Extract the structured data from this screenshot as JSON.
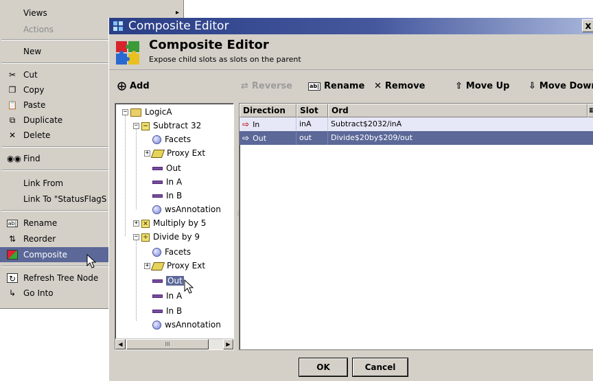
{
  "context_menu": {
    "items": [
      {
        "label": "Views",
        "disabled": false,
        "has_submenu": true
      },
      {
        "label": "Actions",
        "disabled": true
      },
      {
        "label": "New",
        "disabled": false
      },
      {
        "label": "Cut",
        "icon": "scissors-icon"
      },
      {
        "label": "Copy",
        "icon": "copy-icon"
      },
      {
        "label": "Paste",
        "icon": "paste-icon"
      },
      {
        "label": "Duplicate",
        "icon": "duplicate-icon"
      },
      {
        "label": "Delete",
        "icon": "delete-icon"
      },
      {
        "label": "Find",
        "icon": "binoculars-icon"
      },
      {
        "label": "Link From"
      },
      {
        "label": "Link To \"StatusFlagS"
      },
      {
        "label": "Rename",
        "icon": "rename-icon"
      },
      {
        "label": "Reorder",
        "icon": "reorder-icon"
      },
      {
        "label": "Composite",
        "icon": "composite-icon",
        "selected": true
      },
      {
        "label": "Refresh Tree Node",
        "icon": "refresh-icon"
      },
      {
        "label": "Go Into",
        "icon": "go-into-icon"
      }
    ]
  },
  "dialog": {
    "title": "Composite Editor",
    "close_glyph": "x",
    "header_title": "Composite Editor",
    "header_subtitle": "Expose child slots as slots on the parent"
  },
  "toolbar": {
    "add": "Add",
    "reverse": "Reverse",
    "rename": "Rename",
    "remove": "Remove",
    "move_up": "Move Up",
    "move_down": "Move Dowr"
  },
  "tree": {
    "nodes": [
      {
        "label": "LogicA",
        "icon": "folder-icon"
      },
      {
        "label": "Subtract 32",
        "icon": "subtract-block-icon"
      },
      {
        "label": "Facets",
        "icon": "facets-icon"
      },
      {
        "label": "Proxy Ext",
        "icon": "proxy-ext-icon"
      },
      {
        "label": "Out",
        "icon": "slot-icon"
      },
      {
        "label": "In A",
        "icon": "slot-icon"
      },
      {
        "label": "In B",
        "icon": "slot-icon"
      },
      {
        "label": "wsAnnotation",
        "icon": "annotation-icon"
      },
      {
        "label": "Multiply by 5",
        "icon": "multiply-block-icon"
      },
      {
        "label": "Divide by 9",
        "icon": "divide-block-icon"
      },
      {
        "label": "Facets",
        "icon": "facets-icon"
      },
      {
        "label": "Proxy Ext",
        "icon": "proxy-ext-icon"
      },
      {
        "label": "Out",
        "icon": "slot-icon",
        "selected": true
      },
      {
        "label": "In A",
        "icon": "slot-icon"
      },
      {
        "label": "In B",
        "icon": "slot-icon"
      },
      {
        "label": "wsAnnotation",
        "icon": "annotation-icon"
      }
    ],
    "scroll_thumb_label": "III"
  },
  "table": {
    "columns": [
      "Direction",
      "Slot",
      "Ord"
    ],
    "rows": [
      {
        "direction": "In",
        "slot": "inA",
        "ord": "Subtract$2032/inA"
      },
      {
        "direction": "Out",
        "slot": "out",
        "ord": "Divide$20by$209/out"
      }
    ]
  },
  "footer": {
    "ok": "OK",
    "cancel": "Cancel"
  },
  "colors": {
    "selection": "#5b6898",
    "title_bar": "#2a3e86",
    "chrome": "#d4d0c8"
  }
}
